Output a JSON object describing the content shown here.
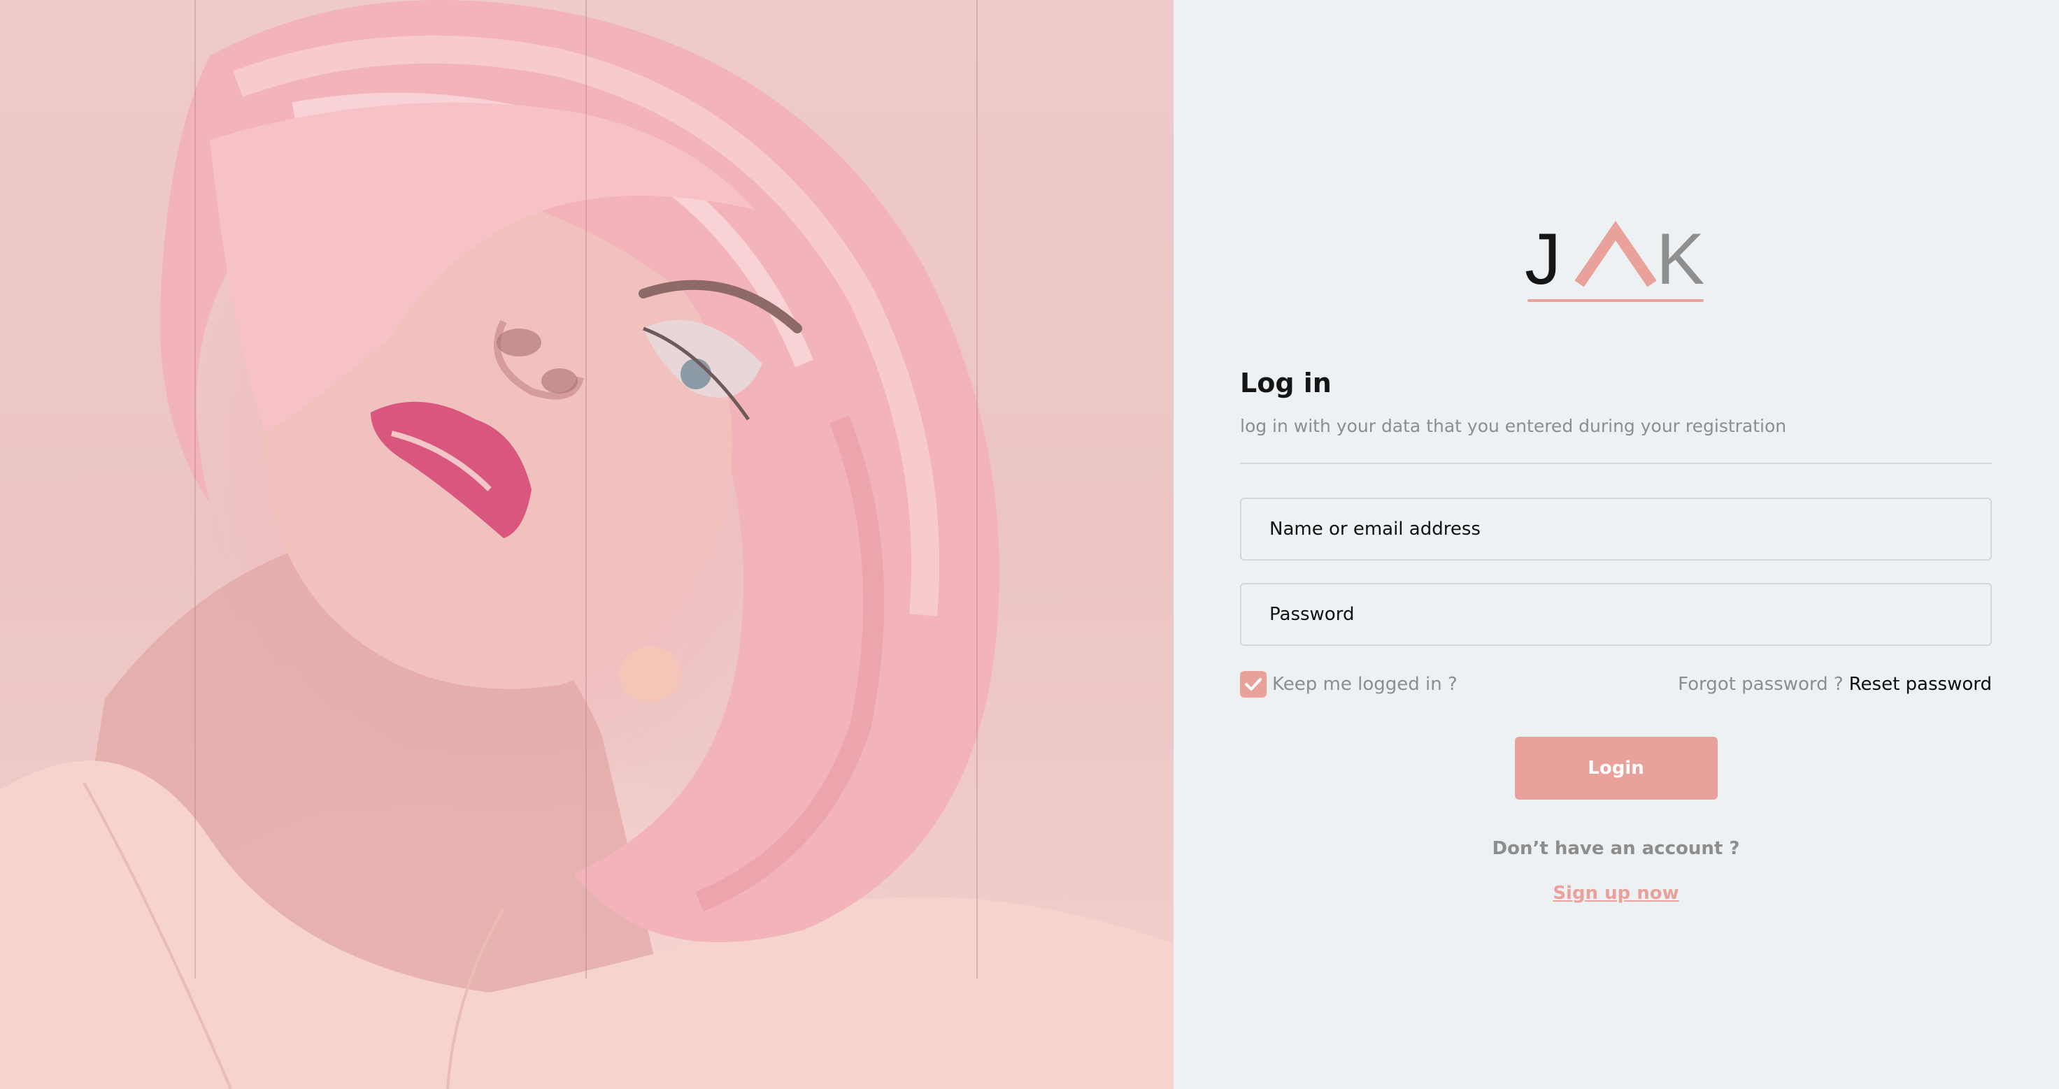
{
  "hero": {
    "image": "woman-pink-hair-portrait"
  },
  "logo": {
    "letters": [
      "J",
      "K"
    ],
    "colors": {
      "j": "#151515",
      "a": "#e8a29b",
      "k": "#8f8f8f",
      "underline": "#e8a29b"
    }
  },
  "form": {
    "title": "Log in",
    "subtitle": "log in with your data that you entered during your registration",
    "username": {
      "placeholder": "Name or email address",
      "value": ""
    },
    "password": {
      "placeholder": "Password",
      "value": ""
    },
    "keep_logged_in": {
      "label": "Keep me logged in ?",
      "checked": true
    },
    "forgot_label": "Forgot password ?",
    "reset_label": "Reset password",
    "login_label": "Login",
    "no_account_label": "Don’t have an account ?",
    "signup_label": "Sign up now"
  },
  "colors": {
    "accent": "#e8a29b",
    "panel_bg": "#edf1f4",
    "muted_text": "#8d8d8d",
    "dark_text": "#151515"
  }
}
